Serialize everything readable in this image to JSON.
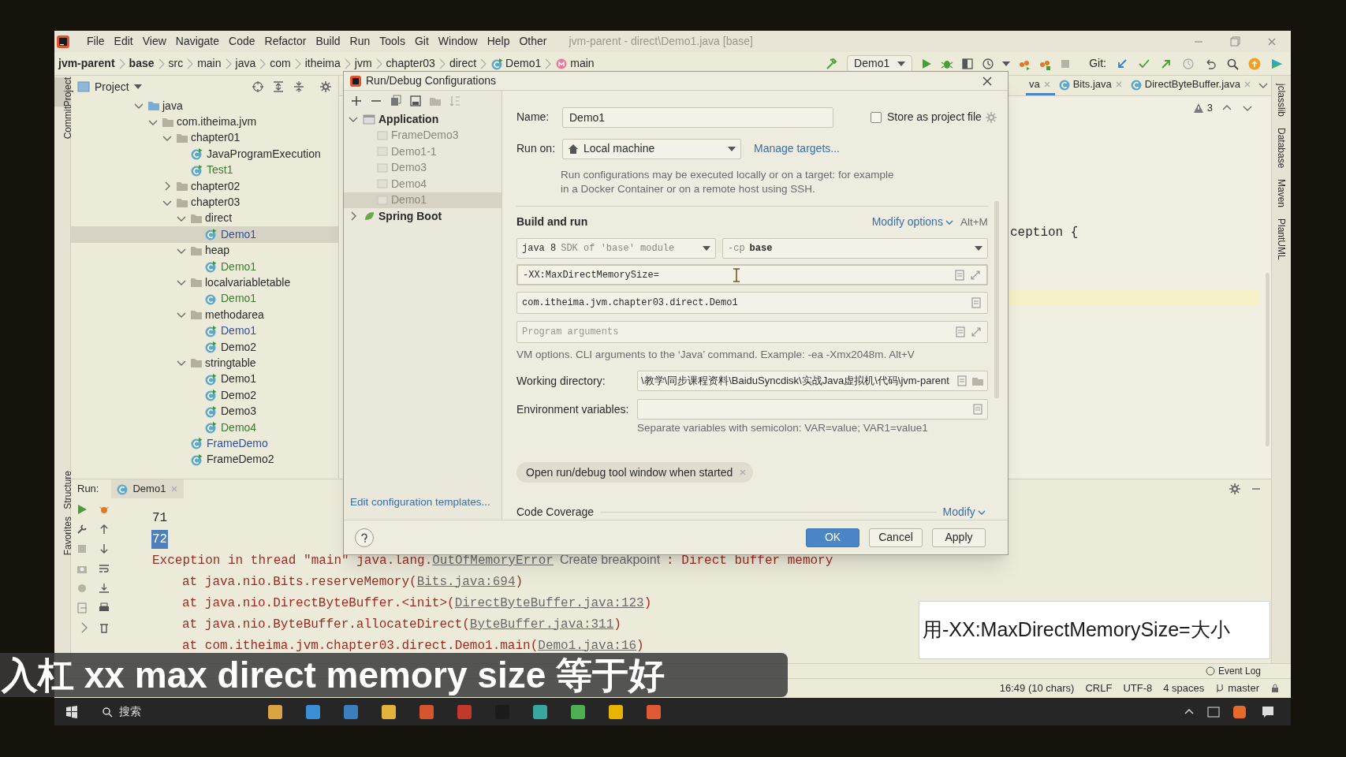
{
  "window": {
    "title": "jvm-parent - direct\\Demo1.java [base]"
  },
  "menu": [
    "File",
    "Edit",
    "View",
    "Navigate",
    "Code",
    "Refactor",
    "Build",
    "Run",
    "Tools",
    "Git",
    "Window",
    "Help",
    "Other"
  ],
  "breadcrumb": [
    {
      "label": "jvm-parent",
      "kind": "text",
      "bold": true
    },
    {
      "label": "base",
      "kind": "text",
      "bold": true
    },
    {
      "label": "src",
      "kind": "text",
      "bold": false
    },
    {
      "label": "main",
      "kind": "text",
      "bold": false
    },
    {
      "label": "java",
      "kind": "text",
      "bold": false
    },
    {
      "label": "com",
      "kind": "text",
      "bold": false
    },
    {
      "label": "itheima",
      "kind": "text",
      "bold": false
    },
    {
      "label": "jvm",
      "kind": "text",
      "bold": false
    },
    {
      "label": "chapter03",
      "kind": "text",
      "bold": false
    },
    {
      "label": "direct",
      "kind": "text",
      "bold": false
    },
    {
      "label": "Demo1",
      "kind": "class",
      "bold": false
    },
    {
      "label": "main",
      "kind": "method",
      "bold": false
    }
  ],
  "toolbar": {
    "run_config": "Demo1",
    "git_label": "Git:"
  },
  "left_strip": [
    {
      "label": "Project",
      "selected": true
    },
    {
      "label": "Commit",
      "selected": false
    },
    {
      "label": "Structure",
      "selected": false
    },
    {
      "label": "Favorites",
      "selected": false
    }
  ],
  "project_panel": {
    "title": "Project",
    "tree": [
      {
        "label": "java",
        "kind": "source_root",
        "expanded": true,
        "selected": false,
        "children": [
          {
            "label": "com.itheima.jvm",
            "kind": "package",
            "expanded": true,
            "selected": false,
            "children": [
              {
                "label": "chapter01",
                "kind": "package",
                "expanded": true,
                "selected": false,
                "children": [
                  {
                    "label": "JavaProgramExecution",
                    "kind": "class",
                    "runnable": true,
                    "color": "#2b2b2b",
                    "selected": false
                  },
                  {
                    "label": "Test1",
                    "kind": "class",
                    "runnable": true,
                    "color": "#3b7d2c",
                    "selected": false
                  }
                ]
              },
              {
                "label": "chapter02",
                "kind": "package",
                "expanded": false,
                "selected": false
              },
              {
                "label": "chapter03",
                "kind": "package",
                "expanded": true,
                "selected": false,
                "children": [
                  {
                    "label": "direct",
                    "kind": "package",
                    "expanded": true,
                    "selected": false,
                    "children": [
                      {
                        "label": "Demo1",
                        "kind": "class",
                        "runnable": true,
                        "color": "#2f4f9c",
                        "selected": true
                      }
                    ]
                  },
                  {
                    "label": "heap",
                    "kind": "package",
                    "expanded": true,
                    "selected": false,
                    "children": [
                      {
                        "label": "Demo1",
                        "kind": "class",
                        "runnable": true,
                        "color": "#3b7d2c",
                        "selected": false
                      }
                    ]
                  },
                  {
                    "label": "localvariabletable",
                    "kind": "package",
                    "expanded": true,
                    "selected": false,
                    "children": [
                      {
                        "label": "Demo1",
                        "kind": "class",
                        "runnable": false,
                        "color": "#3b7d2c",
                        "selected": false
                      }
                    ]
                  },
                  {
                    "label": "methodarea",
                    "kind": "package",
                    "expanded": true,
                    "selected": false,
                    "children": [
                      {
                        "label": "Demo1",
                        "kind": "class",
                        "runnable": true,
                        "color": "#2f4f9c",
                        "selected": false
                      },
                      {
                        "label": "Demo2",
                        "kind": "class",
                        "runnable": true,
                        "color": "#2b2b2b",
                        "selected": false
                      }
                    ]
                  },
                  {
                    "label": "stringtable",
                    "kind": "package",
                    "expanded": true,
                    "selected": false,
                    "children": [
                      {
                        "label": "Demo1",
                        "kind": "class",
                        "runnable": true,
                        "color": "#2b2b2b",
                        "selected": false
                      },
                      {
                        "label": "Demo2",
                        "kind": "class",
                        "runnable": true,
                        "color": "#2b2b2b",
                        "selected": false
                      },
                      {
                        "label": "Demo3",
                        "kind": "class",
                        "runnable": true,
                        "color": "#2b2b2b",
                        "selected": false
                      },
                      {
                        "label": "Demo4",
                        "kind": "class",
                        "runnable": true,
                        "color": "#3b7d2c",
                        "selected": false
                      }
                    ]
                  },
                  {
                    "label": "FrameDemo",
                    "kind": "class",
                    "runnable": true,
                    "color": "#2f4f9c",
                    "selected": false
                  },
                  {
                    "label": "FrameDemo2",
                    "kind": "class",
                    "runnable": true,
                    "color": "#2b2b2b",
                    "selected": false
                  }
                ]
              }
            ]
          }
        ]
      }
    ]
  },
  "editor": {
    "tabs": [
      {
        "label": "va",
        "selected": true
      },
      {
        "label": "Bits.java",
        "selected": false
      },
      {
        "label": "DirectByteBuffer.java",
        "selected": false
      }
    ],
    "warnings": "3",
    "code": "ception {"
  },
  "right_strip": [
    "jclasslib",
    "Database",
    "Maven",
    "PlantUML"
  ],
  "dialog": {
    "title": "Run/Debug Configurations",
    "config_tree": [
      {
        "label": "Application",
        "expanded": true,
        "children": [
          {
            "label": "FrameDemo3",
            "selected": false
          },
          {
            "label": "Demo1-1",
            "selected": false
          },
          {
            "label": "Demo3",
            "selected": false
          },
          {
            "label": "Demo4",
            "selected": false
          },
          {
            "label": "Demo1",
            "selected": true
          }
        ]
      },
      {
        "label": "Spring Boot",
        "expanded": false
      }
    ],
    "templates_link": "Edit configuration templates...",
    "name_label": "Name:",
    "name_value": "Demo1",
    "store_label": "Store as project file",
    "store_checked": false,
    "run_on_label": "Run on:",
    "run_on_value": "Local machine",
    "manage_targets": "Manage targets...",
    "run_on_hint": "Run configurations may be executed locally or on a target: for example in a Docker Container or on a remote host using SSH.",
    "section_title": "Build and run",
    "modify_options": "Modify options",
    "modify_shortcut": "Alt+M",
    "jre": {
      "value": "java 8",
      "hint": "SDK of 'base' module"
    },
    "classpath": {
      "prefix": "-cp",
      "value": "base"
    },
    "vm_options": {
      "value": "-XX:MaxDirectMemorySize=",
      "focused": true
    },
    "main_class": "com.itheima.jvm.chapter03.direct.Demo1",
    "program_arguments": {
      "placeholder": "Program arguments"
    },
    "vm_hint": "VM options. CLI arguments to the ‘Java’ command. Example: -ea -Xmx2048m. Alt+V",
    "working_directory_label": "Working directory:",
    "working_directory": "\\教学\\同步课程资料\\BaiduSyncdisk\\实战Java虚拟机\\代码\\jvm-parent",
    "env_label": "Environment variables:",
    "env_hint": "Separate variables with semicolon: VAR=value; VAR1=value1",
    "chips": [
      "Open run/debug tool window when started"
    ],
    "coverage_title": "Code Coverage",
    "coverage_modify": "Modify",
    "buttons": [
      {
        "label": "OK",
        "kind": "primary"
      },
      {
        "label": "Cancel",
        "kind": "normal"
      },
      {
        "label": "Apply",
        "kind": "normal"
      }
    ]
  },
  "run_panel": {
    "label": "Run:",
    "tab": "Demo1",
    "lines": [
      {
        "kind": "output",
        "selected": false,
        "segments": [
          {
            "kind": "text",
            "text": "71"
          }
        ]
      },
      {
        "kind": "output",
        "selected": true,
        "segments": [
          {
            "kind": "text",
            "text": "72"
          }
        ]
      },
      {
        "kind": "error",
        "selected": false,
        "segments": [
          {
            "kind": "text",
            "text": "Exception in thread \"main\" java.lang."
          },
          {
            "kind": "link",
            "text": "OutOfMemoryError"
          },
          {
            "kind": "hint",
            "text": "Create breakpoint"
          },
          {
            "kind": "text",
            "text": ": Direct buffer memory"
          }
        ]
      },
      {
        "kind": "trace",
        "selected": false,
        "segments": [
          {
            "kind": "text",
            "text": "at java.nio.Bits.reserveMemory("
          },
          {
            "kind": "link",
            "text": "Bits.java:694"
          },
          {
            "kind": "text",
            "text": ")"
          }
        ]
      },
      {
        "kind": "trace",
        "selected": false,
        "segments": [
          {
            "kind": "text",
            "text": "at java.nio.DirectByteBuffer.<init>("
          },
          {
            "kind": "link",
            "text": "DirectByteBuffer.java:123"
          },
          {
            "kind": "text",
            "text": ")"
          }
        ]
      },
      {
        "kind": "trace",
        "selected": false,
        "segments": [
          {
            "kind": "text",
            "text": "at java.nio.ByteBuffer.allocateDirect("
          },
          {
            "kind": "link",
            "text": "ByteBuffer.java:311"
          },
          {
            "kind": "text",
            "text": ")"
          }
        ]
      },
      {
        "kind": "trace",
        "selected": false,
        "segments": [
          {
            "kind": "text",
            "text": "at com.itheima.jvm.chapter03.direct.Demo1.main("
          },
          {
            "kind": "link",
            "text": "Demo1.java:16"
          },
          {
            "kind": "text",
            "text": ")"
          }
        ]
      }
    ]
  },
  "tool_window_bar": {
    "event_log": "Event Log"
  },
  "status_bar": {
    "position": "16:49 (10 chars)",
    "line_ending": "CRLF",
    "encoding": "UTF-8",
    "indent": "4 spaces",
    "branch": "master"
  },
  "taskbar": {
    "search": "搜索"
  },
  "subtitle": "入杠 xx max direct memory size 等于好",
  "annotation": "用-XX:MaxDirectMemorySize=大小"
}
